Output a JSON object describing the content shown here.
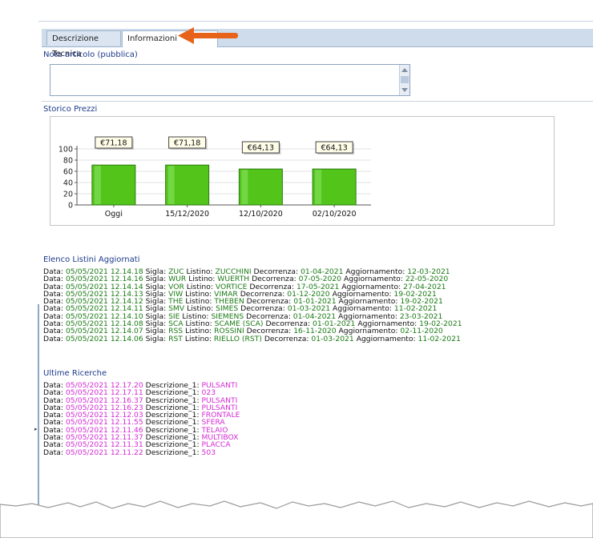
{
  "tabs": [
    {
      "label": "Descrizione Tecnica",
      "active": false
    },
    {
      "label": "Informazioni",
      "active": true
    }
  ],
  "note": {
    "label": "Nota articolo (pubblica)",
    "value": ""
  },
  "price_history": {
    "label": "Storico Prezzi"
  },
  "chart_data": {
    "type": "bar",
    "categories": [
      "Oggi",
      "15/12/2020",
      "12/10/2020",
      "02/10/2020"
    ],
    "values": [
      71.18,
      71.18,
      64.13,
      64.13
    ],
    "data_labels": [
      "€71,18",
      "€71,18",
      "€64,13",
      "€64,13"
    ],
    "ylim": [
      0,
      100
    ],
    "yticks": [
      0,
      20,
      40,
      60,
      80,
      100
    ],
    "bar_color": "#52c41a",
    "grid": true,
    "legend": "none"
  },
  "lists_section": {
    "title": "Elenco Listini Aggiornati",
    "rows": [
      {
        "data": "05/05/2021 12.14.18",
        "sigla": "ZUC",
        "listino": "ZUCCHINI",
        "decorrenza": "01-04-2021",
        "aggiornamento": "12-03-2021"
      },
      {
        "data": "05/05/2021 12.14.16",
        "sigla": "WUR",
        "listino": "WUERTH",
        "decorrenza": "07-05-2020",
        "aggiornamento": "22-05-2020"
      },
      {
        "data": "05/05/2021 12.14.14",
        "sigla": "VOR",
        "listino": "VORTICE",
        "decorrenza": "17-05-2021",
        "aggiornamento": "27-04-2021"
      },
      {
        "data": "05/05/2021 12.14.13",
        "sigla": "VIW",
        "listino": "VIMAR",
        "decorrenza": "01-12-2020",
        "aggiornamento": "19-02-2021"
      },
      {
        "data": "05/05/2021 12.14.12",
        "sigla": "THE",
        "listino": "THEBEN",
        "decorrenza": "01-01-2021",
        "aggiornamento": "19-02-2021"
      },
      {
        "data": "05/05/2021 12.14.11",
        "sigla": "SMV",
        "listino": "SIMES",
        "decorrenza": "01-03-2021",
        "aggiornamento": "11-02-2021"
      },
      {
        "data": "05/05/2021 12.14.10",
        "sigla": "SIE",
        "listino": "SIEMENS",
        "decorrenza": "01-04-2021",
        "aggiornamento": "23-03-2021"
      },
      {
        "data": "05/05/2021 12.14.08",
        "sigla": "SCA",
        "listino": "SCAME (SCA)",
        "decorrenza": "01-01-2021",
        "aggiornamento": "19-02-2021"
      },
      {
        "data": "05/05/2021 12.14.07",
        "sigla": "RSS",
        "listino": "ROSSINI",
        "decorrenza": "16-11-2020",
        "aggiornamento": "02-11-2020"
      },
      {
        "data": "05/05/2021 12.14.06",
        "sigla": "RST",
        "listino": "RIELLO (RST)",
        "decorrenza": "01-03-2021",
        "aggiornamento": "11-02-2021"
      }
    ]
  },
  "searches_section": {
    "title": "Ultime Ricerche",
    "rows": [
      {
        "data": "05/05/2021 12.17.20",
        "descrizione": "PULSANTI"
      },
      {
        "data": "05/05/2021 12.17.11",
        "descrizione": "023"
      },
      {
        "data": "05/05/2021 12.16.37",
        "descrizione": "PULSANTI"
      },
      {
        "data": "05/05/2021 12.16.23",
        "descrizione": "PULSANTI"
      },
      {
        "data": "05/05/2021 12.12.03",
        "descrizione": "FRONTALE"
      },
      {
        "data": "05/05/2021 12.11.55",
        "descrizione": "SFERA"
      },
      {
        "data": "05/05/2021 12.11.46",
        "descrizione": "TELAIO"
      },
      {
        "data": "05/05/2021 12.11.37",
        "descrizione": "MULTIBOX"
      },
      {
        "data": "05/05/2021 12.11.31",
        "descrizione": "PLACCA"
      },
      {
        "data": "05/05/2021 12.11.22",
        "descrizione": "503"
      }
    ]
  },
  "labels": {
    "data": "Data:",
    "sigla": "Sigla:",
    "listino": "Listino:",
    "decorrenza": "Decorrenza:",
    "aggiornamento": "Aggiornamento:",
    "descrizione": "Descrizione_1:"
  },
  "colors": {
    "accent_arrow": "#e8631a",
    "green_text": "#1a7a14",
    "magenta_text": "#d42ad4",
    "section_title": "#1c3a8a"
  }
}
